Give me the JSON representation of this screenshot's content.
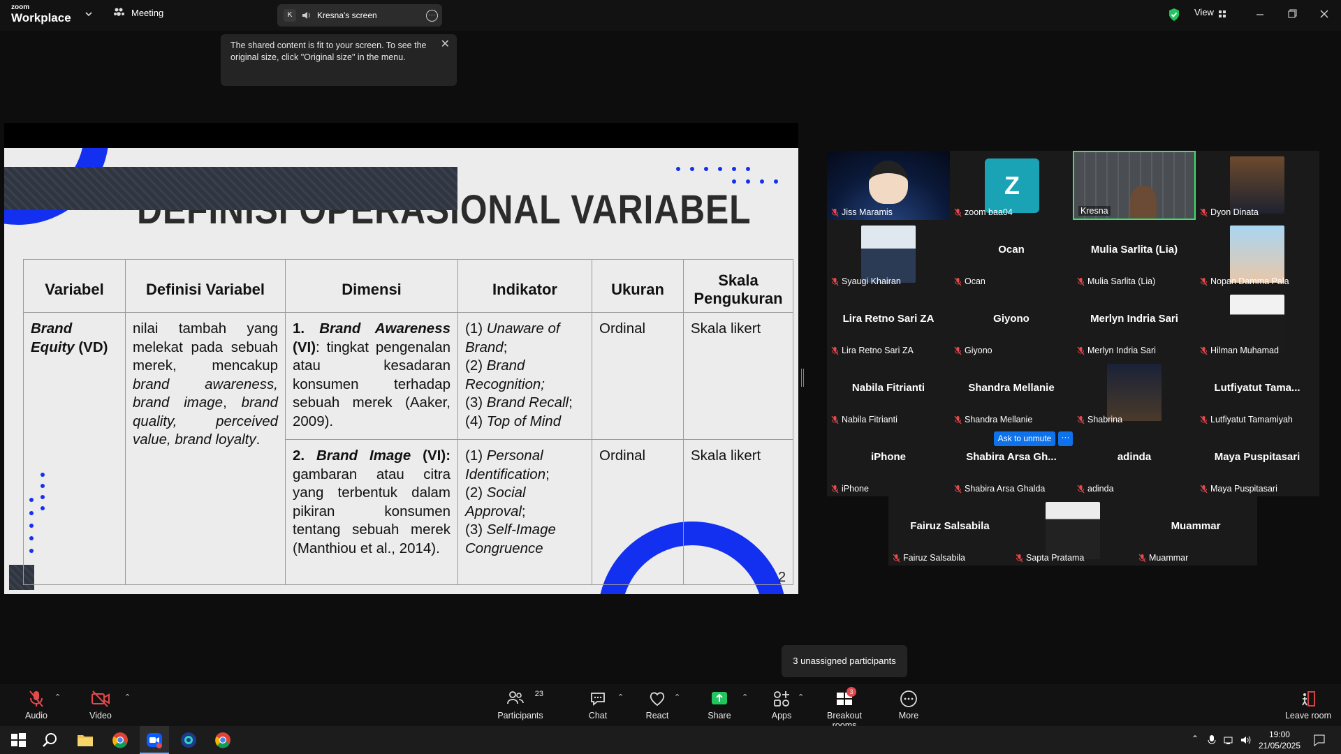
{
  "app": {
    "logo_small": "zoom",
    "logo_big": "Workplace",
    "meeting_label": "Meeting"
  },
  "share": {
    "badge": "K",
    "label": "Kresna's screen"
  },
  "top_right": {
    "view_label": "View"
  },
  "tooltip": {
    "text": "The shared content is fit to your screen. To see the original size, click \"Original size\" in the menu."
  },
  "slide": {
    "title": "DEFINISI OPERASIONAL VARIABEL",
    "page_number": "2",
    "headers": [
      "Variabel",
      "Definisi Variabel",
      "Dimensi",
      "Indikator",
      "Ukuran",
      "Skala Pengukuran"
    ],
    "variable_italic": "Brand Equity",
    "variable_suffix": " (VD)",
    "definition_plain_1": "nilai tambah yang melekat pada sebuah merek, mencakup ",
    "definition_italic": "brand awareness, brand image",
    "definition_plain_2": ", ",
    "definition_italic_2": "brand quality, perceived value, brand loyalty",
    "definition_end": ".",
    "dim1_num": "1. ",
    "dim1_name": "Brand Awareness",
    "dim1_tag": " (VI)",
    "dim1_text": ": tingkat pengenalan atau kesadaran konsumen terhadap sebuah merek (Aaker, 2009).",
    "dim2_num": "2. ",
    "dim2_name": "Brand Image",
    "dim2_tag": " (VI):",
    "dim2_text": " gambaran atau citra yang terbentuk dalam pikiran konsumen tentang sebuah merek (Manthiou et al., 2014).",
    "ind1": [
      {
        "num": "(1) ",
        "text": "Unaware of Brand",
        "end": ";"
      },
      {
        "num": "(2) ",
        "text": "Brand Recognition;",
        "end": ""
      },
      {
        "num": "(3) ",
        "text": "Brand Recall",
        "end": ";"
      },
      {
        "num": "(4) ",
        "text": "Top of Mind",
        "end": ""
      }
    ],
    "ind2": [
      {
        "num": "(1) ",
        "text": "Personal Identification",
        "end": ";"
      },
      {
        "num": "(2) ",
        "text": "Social Approval",
        "end": ";"
      },
      {
        "num": "(3) ",
        "text": "Self-Image Congruence",
        "end": ""
      }
    ],
    "ukuran": "Ordinal",
    "skala": "Skala likert"
  },
  "participants": [
    {
      "center": "",
      "label": "Jiss Maramis"
    },
    {
      "center": "Z",
      "label": "zoom baa04"
    },
    {
      "center": "",
      "label": "Kresna"
    },
    {
      "center": "",
      "label": "Dyon Dinata"
    },
    {
      "center": "",
      "label": "Syaugi Khairan"
    },
    {
      "center": "Ocan",
      "label": "Ocan"
    },
    {
      "center": "Mulia Sarlita (Lia)",
      "label": "Mulia Sarlita (Lia)"
    },
    {
      "center": "",
      "label": "Nopan Damma Pala"
    },
    {
      "center": "Lira Retno Sari ZA",
      "label": "Lira Retno Sari ZA"
    },
    {
      "center": "Giyono",
      "label": "Giyono"
    },
    {
      "center": "Merlyn Indria Sari",
      "label": "Merlyn Indria Sari"
    },
    {
      "center": "",
      "label": "Hilman Muhamad"
    },
    {
      "center": "Nabila Fitrianti",
      "label": "Nabila Fitrianti"
    },
    {
      "center": "Shandra Mellanie",
      "label": "Shandra Mellanie"
    },
    {
      "center": "",
      "label": "Shabrina"
    },
    {
      "center": "Lutfiyatut Tama...",
      "label": "Lutfiyatut Tamamiyah"
    },
    {
      "center": "iPhone",
      "label": "iPhone"
    },
    {
      "center": "Shabira Arsa Gh...",
      "label": "Shabira Arsa Ghalda"
    },
    {
      "center": "adinda",
      "label": "adinda"
    },
    {
      "center": "Maya Puspitasari",
      "label": "Maya Puspitasari"
    },
    {
      "center": "Fairuz Salsabila",
      "label": "Fairuz Salsabila"
    },
    {
      "center": "",
      "label": "Sapta Pratama"
    },
    {
      "center": "Muammar",
      "label": "Muammar"
    }
  ],
  "ask_to_unmute": "Ask to unmute",
  "ask_more": "···",
  "unassigned_tip": "3 unassigned participants",
  "toolbar": {
    "audio": "Audio",
    "video": "Video",
    "participants": "Participants",
    "participants_count": "23",
    "chat": "Chat",
    "react": "React",
    "share": "Share",
    "apps": "Apps",
    "breakout": "Breakout rooms",
    "breakout_badge": "3",
    "more": "More",
    "leave": "Leave room"
  },
  "taskbar": {
    "time": "19:00",
    "date": "21/05/2025"
  },
  "colors": {
    "accent_blue": "#1330f0",
    "zoom_blue": "#0e72ed",
    "active_green": "#3ce06a",
    "mic_red": "#e5484d"
  }
}
